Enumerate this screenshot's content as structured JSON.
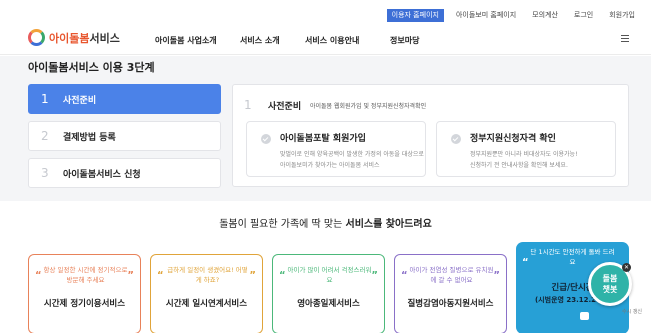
{
  "topbar": {
    "links": [
      "이용자 홈페이지",
      "아이돌보미 홈페이지",
      "모의계산",
      "로그인",
      "회원가입"
    ]
  },
  "header": {
    "logo_prefix": "아이돌봄",
    "logo_suffix": "서비스",
    "nav": [
      "아이돌봄 사업소개",
      "서비스 소개",
      "서비스 이용안내",
      "정보마당"
    ]
  },
  "steps": {
    "title": "아이돌봄서비스 이용 3단계",
    "items": [
      {
        "num": "1",
        "label": "사전준비"
      },
      {
        "num": "2",
        "label": "결제방법 등록"
      },
      {
        "num": "3",
        "label": "아이돌봄서비스 신청"
      }
    ],
    "detail": {
      "num": "1",
      "title": "사전준비",
      "subtitle": "아이돌봄 웹회원가입 및 정부지원신청자격확인",
      "cards": [
        {
          "title": "아이돌봄포탈 회원가입",
          "desc1": "맞벌이로 인해 양육공백이 발생한 가정의 아동을 대상으로",
          "desc2": "아이돌보미가 찾아가는 아이돌봄 서비스"
        },
        {
          "title": "정부지원신청자격 확인",
          "desc1": "정부지원뿐만 아니라 비대상자도 이용가능!",
          "desc2": "신청하기 전 안내사항을 확인해 보세요."
        }
      ]
    }
  },
  "services": {
    "heading_pre": "돌봄이 필요한 가족에 딱 맞는 ",
    "heading_bold": "서비스를 찾아드려요",
    "cards": [
      {
        "desc": "항상 일정한 시간에 정기적으로 방문해 주세요",
        "name": "시간제 정기이용서비스",
        "color": "#e8825a"
      },
      {
        "desc": "급하게 일정이 생겼어요! 어떻게 하죠?",
        "name": "시간제 일시연계서비스",
        "color": "#e0a43a"
      },
      {
        "desc": "아이가 많이 어려서 걱정스러워요",
        "name": "영아종일제서비스",
        "color": "#4cb87a"
      },
      {
        "desc": "아이가 전염성 질병으로 유치원에 갈 수 없어요",
        "name": "질병감염아동지원서비스",
        "color": "#8a70c8"
      }
    ],
    "featured": {
      "desc": "단 1시간도 안전하게 돌봐 드려요",
      "name": "긴급/단시간",
      "sub": "(시범운영 23.12.20~)"
    }
  },
  "chatbot": {
    "label": "돌봄\n챗봇",
    "note": "수시 갱신"
  },
  "colors": {
    "accent": "#4b82e8",
    "featured": "#27a0d6"
  }
}
